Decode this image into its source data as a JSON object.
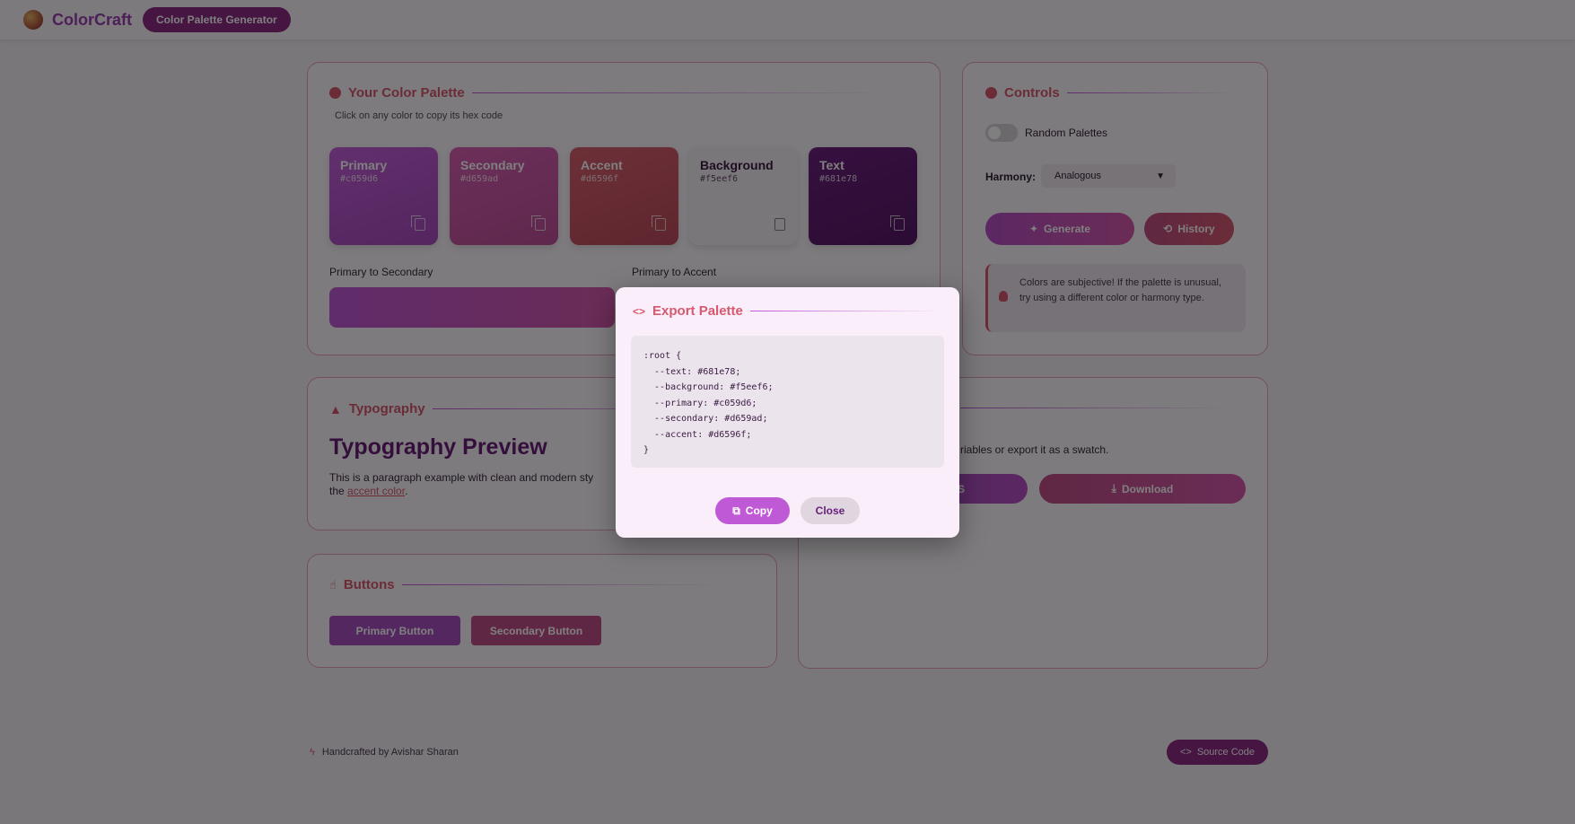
{
  "header": {
    "app_name": "ColorCraft",
    "badge": "Color Palette Generator"
  },
  "palette": {
    "title": "Your Color Palette",
    "subtitle": "Click on any color to copy its hex code",
    "swatches": [
      {
        "name": "Primary",
        "hex": "#c059d6"
      },
      {
        "name": "Secondary",
        "hex": "#d659ad"
      },
      {
        "name": "Accent",
        "hex": "#d6596f"
      },
      {
        "name": "Background",
        "hex": "#f5eef6"
      },
      {
        "name": "Text",
        "hex": "#681e78"
      }
    ],
    "gradient1_label": "Primary to Secondary",
    "gradient2_label": "Primary to Accent"
  },
  "controls": {
    "title": "Controls",
    "toggle_label": "Random Palettes",
    "harmony_label": "Harmony:",
    "harmony_value": "Analogous",
    "generate_label": "Generate",
    "history_label": "History",
    "tip": "Colors are subjective! If the palette is unusual, try using a different color or harmony type."
  },
  "typography": {
    "title": "Typography",
    "preview_heading": "Typography Preview",
    "paragraph_start": "This is a paragraph example with clean and modern sty",
    "paragraph_line2": "the",
    "link_text": "accent color",
    "link_suffix": "."
  },
  "export_card": {
    "description_fragment": "riables or export it as a swatch.",
    "css_button_fragment": "S",
    "download_label": "Download"
  },
  "buttons_card": {
    "title": "Buttons",
    "primary_label": "Primary Button",
    "secondary_label": "Secondary Button"
  },
  "footer": {
    "credit": "Handcrafted by Avishar Sharan",
    "source_label": "Source Code"
  },
  "modal": {
    "title": "Export Palette",
    "code": ":root {\n  --text: #681e78;\n  --background: #f5eef6;\n  --primary: #c059d6;\n  --secondary: #d659ad;\n  --accent: #d6596f;\n}",
    "copy_label": "Copy",
    "close_label": "Close"
  },
  "colors": {
    "primary": "#c059d6",
    "secondary": "#d659ad",
    "accent": "#d6596f",
    "background": "#f5eef6",
    "text": "#681e78"
  }
}
